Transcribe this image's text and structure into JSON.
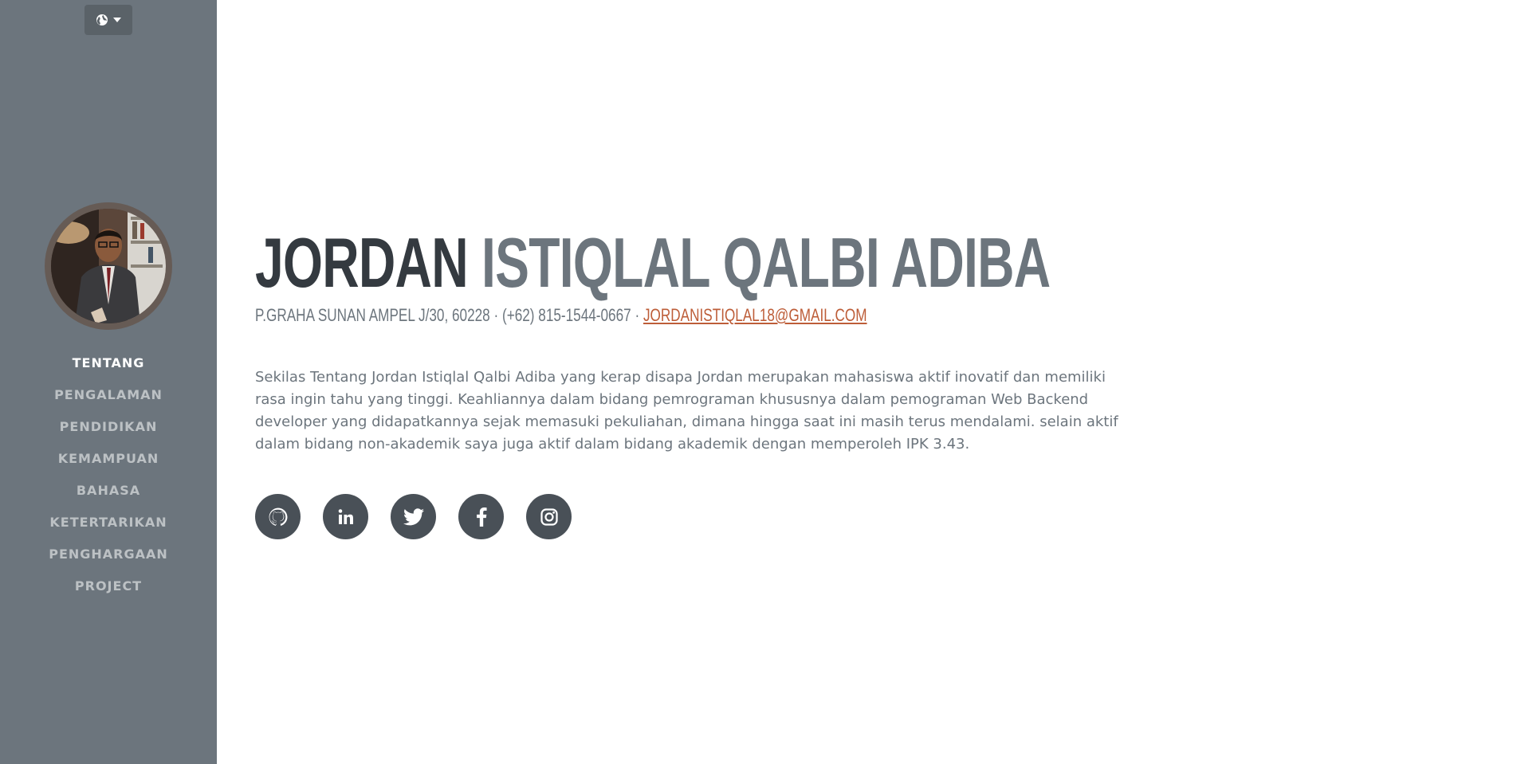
{
  "language_toggle": {
    "icon": "globe-icon",
    "caret": "caret-down-icon"
  },
  "sidebar": {
    "avatar_icon": "profile-photo",
    "items": [
      {
        "label": "Tentang",
        "active": true
      },
      {
        "label": "Pengalaman",
        "active": false
      },
      {
        "label": "Pendidikan",
        "active": false
      },
      {
        "label": "Kemampuan",
        "active": false
      },
      {
        "label": "Bahasa",
        "active": false
      },
      {
        "label": "Ketertarikan",
        "active": false
      },
      {
        "label": "Penghargaan",
        "active": false
      },
      {
        "label": "Project",
        "active": false
      }
    ]
  },
  "profile": {
    "first_name": "Jordan",
    "last_name": "Istiqlal Qalbi Adiba",
    "address": "P.Graha Sunan Ampel J/30, 60228 · (+62) 815-1544-0667 · ",
    "email": "jordanistiqlal18@gmail.com",
    "bio": "Sekilas Tentang Jordan Istiqlal Qalbi Adiba yang kerap disapa Jordan merupakan mahasiswa aktif inovatif dan memiliki rasa ingin tahu yang tinggi. Keahliannya dalam bidang pemrograman khususnya dalam pemograman Web Backend developer yang didapatkannya sejak memasuki pekuliahan, dimana hingga saat ini masih terus mendalami. selain aktif dalam bidang non-akademik saya juga aktif dalam bidang akademik dengan memperoleh IPK 3.43."
  },
  "social": [
    {
      "icon": "github-icon"
    },
    {
      "icon": "linkedin-icon"
    },
    {
      "icon": "twitter-icon"
    },
    {
      "icon": "facebook-icon"
    },
    {
      "icon": "instagram-icon"
    }
  ],
  "colors": {
    "sidebar_bg": "#6c757d",
    "first_name": "#343a40",
    "last_name": "#6c757d",
    "accent": "#bd5d38",
    "social_bg": "#495057"
  }
}
